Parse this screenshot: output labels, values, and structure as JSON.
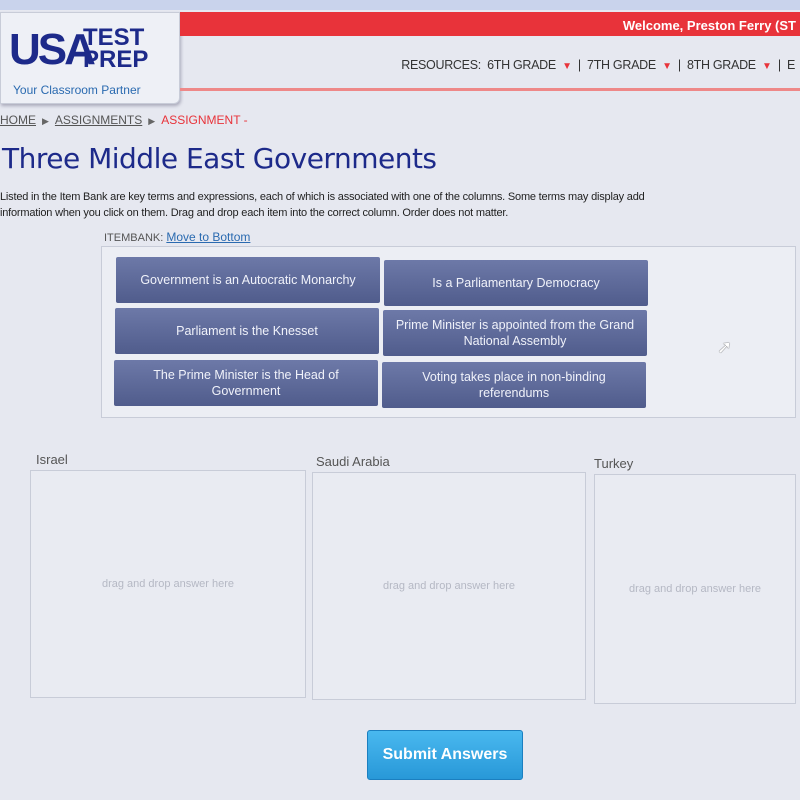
{
  "header": {
    "welcome": "Welcome, Preston Ferry (ST",
    "logo_text": "USA TEST PREP",
    "logo_usa": "USA",
    "logo_test": "TEST",
    "logo_prep": "PREP",
    "tagline": "Your Classroom Partner",
    "nav": [
      {
        "label": "RESOURCES:"
      },
      {
        "label": "6TH GRADE"
      },
      {
        "label": "7TH GRADE"
      },
      {
        "label": "8TH GRADE"
      },
      {
        "label": "E"
      }
    ]
  },
  "breadcrumb": [
    "HOME",
    "ASSIGNMENTS",
    "ASSIGNMENT -"
  ],
  "title": "Three Middle East Governments",
  "instructions": [
    "Listed in the Item Bank are key terms and expressions, each of which is associated with one of the columns. Some terms may display add",
    "information when you click on them. Drag and drop each item into the correct column. Order does not matter."
  ],
  "itembank": {
    "label": "ITEMBANK:",
    "move_link": "Move to Bottom",
    "items": [
      "Government is an Autocratic Monarchy",
      "Is a Parliamentary Democracy",
      "Parliament is the Knesset",
      "Prime Minister is appointed from the Grand National Assembly",
      "The Prime Minister is the Head of Government",
      "Voting takes place in non-binding referendums"
    ]
  },
  "columns": [
    {
      "label": "Israel",
      "placeholder": "drag and drop answer here"
    },
    {
      "label": "Saudi Arabia",
      "placeholder": "drag and drop answer here"
    },
    {
      "label": "Turkey",
      "placeholder": "drag and drop answer here"
    }
  ],
  "submit_label": "Submit Answers",
  "colors": {
    "accent_red": "#e8333a",
    "brand_blue": "#1d2a8a",
    "item_bg": "#5a6696",
    "submit": "#2fa5e4"
  }
}
